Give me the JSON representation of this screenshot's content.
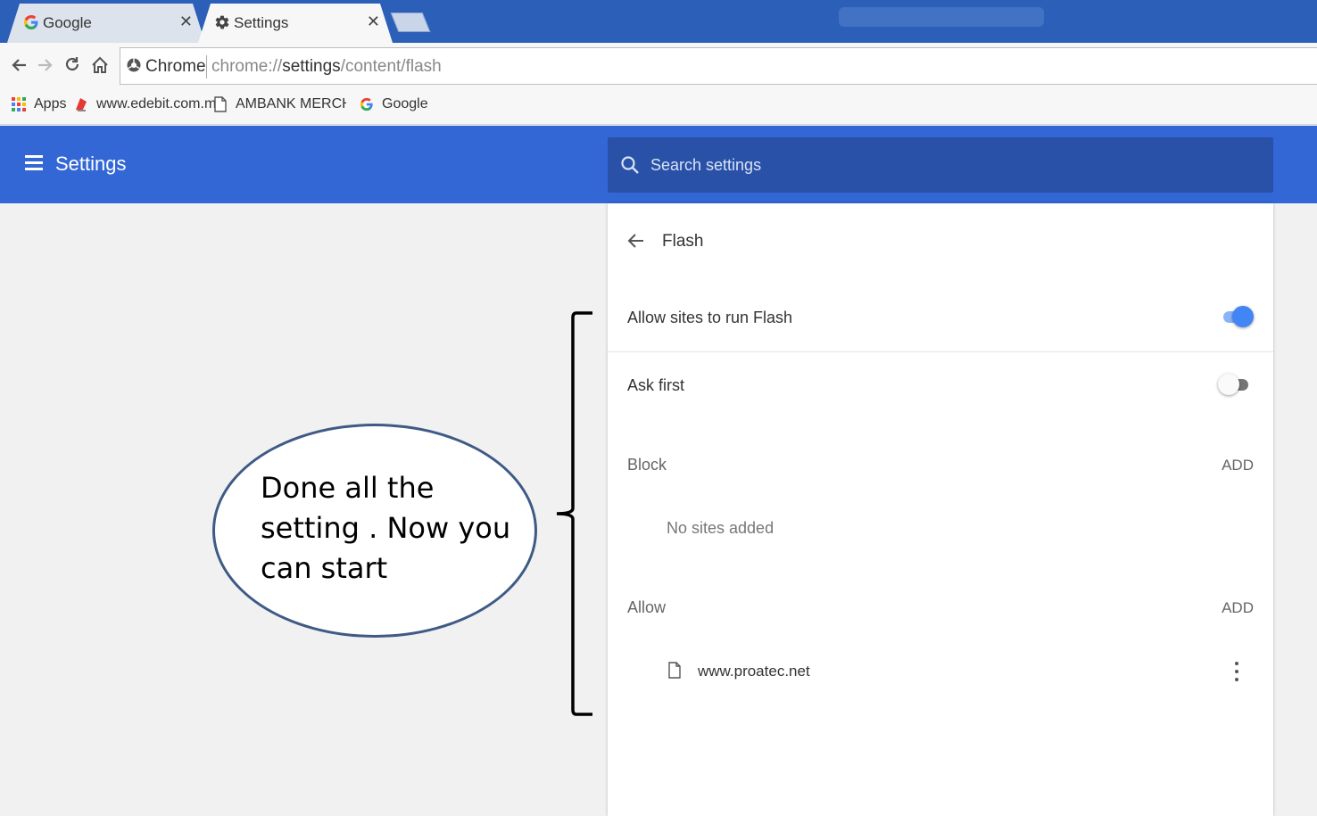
{
  "tabs": [
    {
      "title": "Google",
      "icon": "google-g-icon",
      "active": false
    },
    {
      "title": "Settings",
      "icon": "gear-icon",
      "active": true
    }
  ],
  "toolbar": {
    "omnibox_chip": "Chrome",
    "url_prefix": "chrome://",
    "url_host": "settings",
    "url_path": "/content/flash"
  },
  "bookmarks": [
    {
      "label": "Apps",
      "icon": "apps-grid-icon"
    },
    {
      "label": "www.edebit.com.my",
      "icon": "edebit-favicon"
    },
    {
      "label": "AMBANK MERCHANT",
      "icon": "page-icon"
    },
    {
      "label": "Google",
      "icon": "google-g-icon"
    }
  ],
  "header": {
    "title": "Settings",
    "search_placeholder": "Search settings"
  },
  "flash": {
    "title": "Flash",
    "allow_sites_label": "Allow sites to run Flash",
    "allow_sites_enabled": true,
    "ask_first_label": "Ask first",
    "ask_first_enabled": false,
    "block_label": "Block",
    "block_add": "ADD",
    "block_empty": "No sites added",
    "allow_label": "Allow",
    "allow_add": "ADD",
    "allow_sites": [
      {
        "site": "www.proatec.net"
      }
    ]
  },
  "annotation": {
    "lines": [
      "Done all the",
      "setting . Now you",
      "can start"
    ]
  },
  "colors": {
    "tabstrip": "#2b5fb8",
    "settings_bar": "#3367d6",
    "search_box": "#2a51a8",
    "toggle_on": "#4285f4",
    "toggle_on_track": "#8ab4f8",
    "toggle_off_knob": "#fafafa",
    "toggle_off_track": "#757575",
    "bubble_border": "#3e5a85"
  }
}
